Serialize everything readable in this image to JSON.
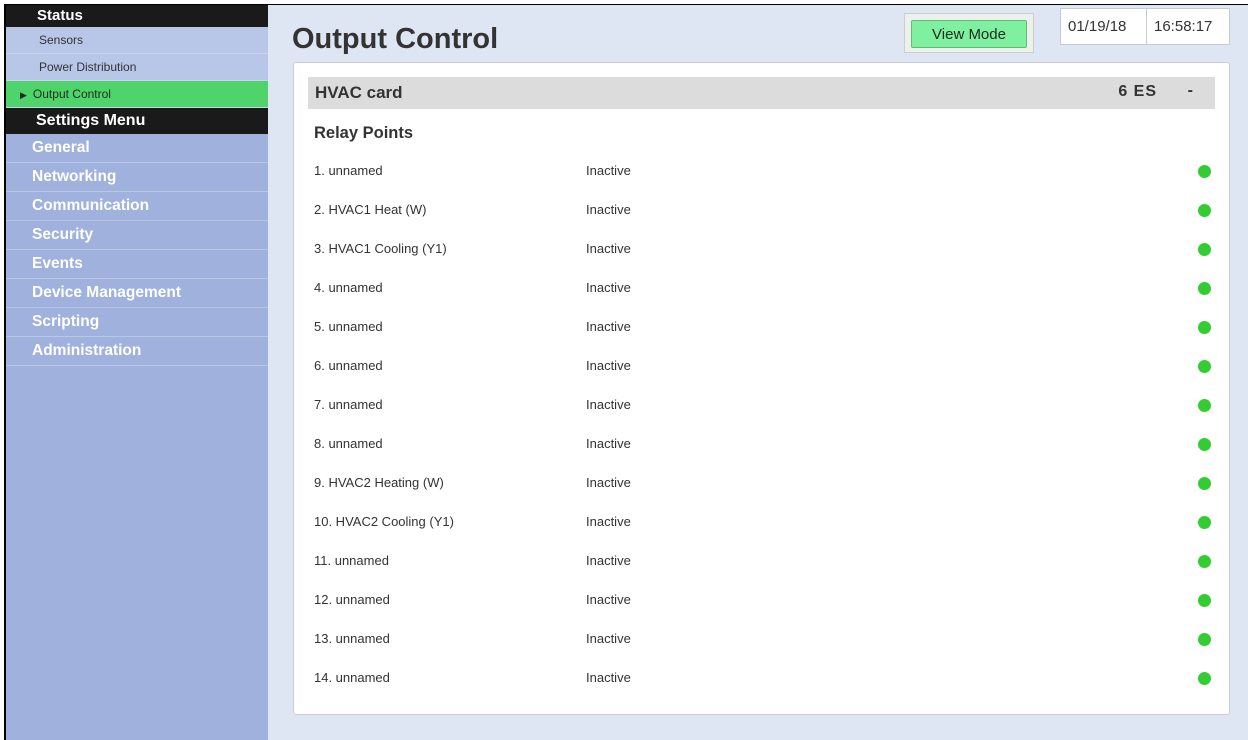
{
  "sidebar": {
    "status_heading": "Status",
    "status_items": [
      {
        "label": "Sensors"
      },
      {
        "label": "Power Distribution"
      },
      {
        "label": "Output Control"
      }
    ],
    "settings_heading": "Settings Menu",
    "menu_items": [
      {
        "label": "General"
      },
      {
        "label": "Networking"
      },
      {
        "label": "Communication"
      },
      {
        "label": "Security"
      },
      {
        "label": "Events"
      },
      {
        "label": "Device Management"
      },
      {
        "label": "Scripting"
      },
      {
        "label": "Administration"
      }
    ]
  },
  "header": {
    "title": "Output Control",
    "view_mode_label": "View Mode",
    "date": "01/19/18",
    "time": "16:58:17"
  },
  "card": {
    "title": "HVAC card",
    "code": "6 ES",
    "collapse_symbol": "-"
  },
  "relay": {
    "heading": "Relay Points",
    "status_color": "#33cc33",
    "points": [
      {
        "name": "1. unnamed",
        "state": "Inactive"
      },
      {
        "name": "2. HVAC1 Heat (W)",
        "state": "Inactive"
      },
      {
        "name": "3. HVAC1 Cooling (Y1)",
        "state": "Inactive"
      },
      {
        "name": "4. unnamed",
        "state": "Inactive"
      },
      {
        "name": "5. unnamed",
        "state": "Inactive"
      },
      {
        "name": "6. unnamed",
        "state": "Inactive"
      },
      {
        "name": "7. unnamed",
        "state": "Inactive"
      },
      {
        "name": "8. unnamed",
        "state": "Inactive"
      },
      {
        "name": "9. HVAC2 Heating (W)",
        "state": "Inactive"
      },
      {
        "name": "10. HVAC2 Cooling (Y1)",
        "state": "Inactive"
      },
      {
        "name": "11. unnamed",
        "state": "Inactive"
      },
      {
        "name": "12. unnamed",
        "state": "Inactive"
      },
      {
        "name": "13. unnamed",
        "state": "Inactive"
      },
      {
        "name": "14. unnamed",
        "state": "Inactive"
      }
    ]
  },
  "icons": {
    "active_arrow": "triangle-right-icon",
    "status_dot": "status-dot-icon"
  }
}
